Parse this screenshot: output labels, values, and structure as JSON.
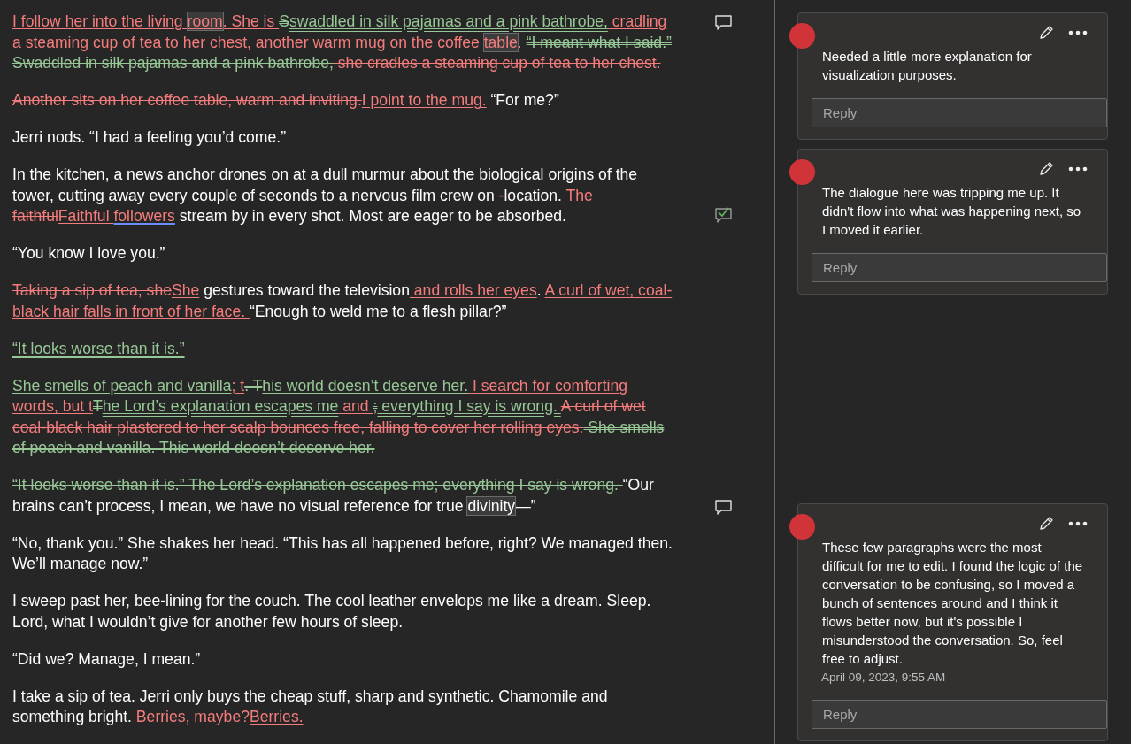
{
  "document": {
    "paragraphs": [
      {
        "runs": [
          {
            "kind": "insert",
            "text": "I follow her into the living "
          },
          {
            "kind": "insert_anchor",
            "text": "room"
          },
          {
            "kind": "insert",
            "text": ". She is "
          },
          {
            "kind": "move_from",
            "text": "S"
          },
          {
            "kind": "move_to",
            "text": "swaddled in silk pajamas and a pink bathrobe,"
          },
          {
            "kind": "insert",
            "text": " cradling a steaming cup of tea to her chest, another warm mug on the coffee "
          },
          {
            "kind": "insert_anchor",
            "text": "table"
          },
          {
            "kind": "insert",
            "text": ". "
          },
          {
            "kind": "move_from",
            "text": "“I meant what I said.” Swaddled in silk pajamas and a pink bathrobe,"
          },
          {
            "kind": "delete",
            "text": " she cradles a steaming cup of tea to her chest."
          }
        ]
      },
      {
        "runs": [
          {
            "kind": "delete",
            "text": "Another sits on her coffee table, warm and inviting."
          },
          {
            "kind": "insert",
            "text": "I point to the mug."
          },
          {
            "kind": "plain",
            "text": " “For me?”"
          }
        ]
      },
      {
        "runs": [
          {
            "kind": "plain",
            "text": "Jerri nods. “I had a feeling you’d come.”"
          }
        ]
      },
      {
        "runs": [
          {
            "kind": "plain",
            "text": "In the kitchen, a news anchor drones on at a dull murmur about the biological origins of the tower, cutting away every couple of seconds to a nervous film crew on "
          },
          {
            "kind": "delete",
            "text": "-"
          },
          {
            "kind": "plain",
            "text": "location. "
          },
          {
            "kind": "delete",
            "text": "The faithful"
          },
          {
            "kind": "insert",
            "text": "Faithful "
          },
          {
            "kind": "insert_flagged",
            "text": "followers"
          },
          {
            "kind": "plain",
            "text": " stream by in every shot. Most are eager to be absorbed."
          }
        ]
      },
      {
        "runs": [
          {
            "kind": "plain",
            "text": "“You know I love you.”"
          }
        ]
      },
      {
        "runs": [
          {
            "kind": "delete",
            "text": "Taking a sip of tea, she"
          },
          {
            "kind": "insert",
            "text": "She"
          },
          {
            "kind": "plain",
            "text": " gestures toward the television"
          },
          {
            "kind": "insert",
            "text": " and rolls her eyes"
          },
          {
            "kind": "plain",
            "text": ". "
          },
          {
            "kind": "insert",
            "text": "A curl of wet, coal-black hair falls in front of her face. "
          },
          {
            "kind": "plain",
            "text": "“Enough to weld me to a flesh pillar?”"
          }
        ]
      },
      {
        "runs": [
          {
            "kind": "move_to",
            "text": "“It looks worse than it is.”"
          }
        ]
      },
      {
        "runs": [
          {
            "kind": "move_to",
            "text": "She smells of peach and vanilla"
          },
          {
            "kind": "insert",
            "text": "; t"
          },
          {
            "kind": "move_from",
            "text": ". T"
          },
          {
            "kind": "move_to",
            "text": "his world doesn’t deserve her."
          },
          {
            "kind": "insert",
            "text": " I search for comforting words, but t"
          },
          {
            "kind": "move_from",
            "text": "T"
          },
          {
            "kind": "move_to",
            "text": "he Lord’s explanation escapes me"
          },
          {
            "kind": "insert",
            "text": " and "
          },
          {
            "kind": "move_from",
            "text": ";"
          },
          {
            "kind": "move_to",
            "text": " everything I say is wrong. "
          },
          {
            "kind": "delete",
            "text": "A curl of wet coal-black hair plastered to her scalp bounces free, falling to cover her rolling eyes."
          },
          {
            "kind": "move_from",
            "text": " She smells of peach and vanilla. This world doesn’t deserve her."
          }
        ]
      },
      {
        "runs": [
          {
            "kind": "move_from",
            "text": "“It looks worse than it is.” The Lord’s explanation escapes me; everything I say is wrong. "
          },
          {
            "kind": "plain",
            "text": "“Our brains can’t process, I mean, we have no visual reference for true "
          },
          {
            "kind": "plain_anchor",
            "text": "divinity"
          },
          {
            "kind": "plain",
            "text": "—”"
          }
        ]
      },
      {
        "runs": [
          {
            "kind": "plain",
            "text": "“No, thank you.” She shakes her head. “This has all happened before, right? We managed then. We’ll manage now.”"
          }
        ]
      },
      {
        "runs": [
          {
            "kind": "plain",
            "text": "I sweep past her, bee-lining for the couch. The cool leather envelops me like a dream. Sleep. Lord, what I wouldn’t give for another few hours of sleep."
          }
        ]
      },
      {
        "runs": [
          {
            "kind": "plain",
            "text": "“Did we? Manage, I mean.”"
          }
        ]
      },
      {
        "runs": [
          {
            "kind": "plain",
            "text": "I take a sip of tea. Jerri only buys the cheap stuff, sharp and synthetic. Chamomile and something bright. "
          },
          {
            "kind": "delete",
            "text": "Berries, maybe?"
          },
          {
            "kind": "insert",
            "text": "Berries."
          }
        ]
      }
    ]
  },
  "markers": [
    {
      "resolved": false
    },
    {
      "resolved": true
    },
    {
      "resolved": false
    }
  ],
  "comments": [
    {
      "text": "Needed a little more explanation for visualization purposes.",
      "reply_placeholder": "Reply"
    },
    {
      "text": "The dialogue here was tripping me up. It didn't flow into what was happening next, so I moved it earlier.",
      "reply_placeholder": "Reply"
    },
    {
      "text": "These few paragraphs were the most difficult for me to edit. I found the logic of the conversation to be confusing, so I moved a bunch of sentences around and I think it flows better now, but it's possible I misunderstood the conversation. So, feel free to adjust.",
      "timestamp": "April 09, 2023, 9:55 AM",
      "reply_placeholder": "Reply"
    }
  ]
}
